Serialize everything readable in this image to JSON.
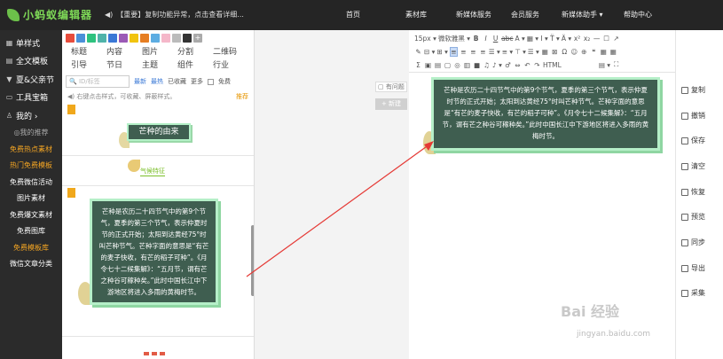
{
  "app": {
    "logo_text": "小蚂蚁编辑器",
    "notice": "【重要】复制功能异常，点击查看详细...",
    "nav": [
      "首页",
      "素材库",
      "新媒体服务",
      "会员服务",
      "新媒体助手 ▾",
      "帮助中心"
    ]
  },
  "sidebar": {
    "items": [
      {
        "icon": "单",
        "label": "单样式"
      },
      {
        "icon": "全",
        "label": "全文模板"
      },
      {
        "icon": "夏",
        "label": "夏&父亲节"
      },
      {
        "icon": "工",
        "label": "工具宝箱"
      },
      {
        "icon": "我",
        "label": "我的 ›"
      }
    ],
    "subs": [
      {
        "label": "◎我的推荐",
        "style": "dim"
      },
      {
        "label": "免费热点素材",
        "style": "hot"
      },
      {
        "label": "热门免费模板",
        "style": "hot"
      },
      {
        "label": "免费微信活动",
        "style": ""
      },
      {
        "label": "图片素材",
        "style": ""
      },
      {
        "label": "免费爆文素材",
        "style": ""
      },
      {
        "label": "免费图库",
        "style": ""
      },
      {
        "label": "免费模板库",
        "style": "hot"
      },
      {
        "label": "微信文章分类",
        "style": ""
      }
    ]
  },
  "panel": {
    "swatch_colors": [
      "#e74c3c",
      "#4a90d9",
      "#2ec27e",
      "#4fb3a9",
      "#3a78d6",
      "#9b59b6",
      "#f1c40f",
      "#e67e22",
      "#5dade2",
      "#f5b7c9",
      "#bbbbbb",
      "#333333"
    ],
    "categories": [
      "标题",
      "内容",
      "图片",
      "分割",
      "二维码",
      "引导",
      "节日",
      "主题",
      "组件",
      "行业"
    ],
    "search_placeholder": "ID/标签",
    "filters": [
      "最新",
      "最热",
      "已收藏",
      "更多",
      "免费"
    ],
    "tip": "◀) 右键点击样式，可收藏、屏蔽样式。",
    "tip_link": "推荐",
    "card1_title": "芒种的由来",
    "card2_label": "气候特征",
    "card3_text": "芒种是农历二十四节气中的第9个节气，夏季的第三个节气，表示仲夏时节的正式开始；太阳到达黄经75°时叫芒种节气。芒种字面的意思是“有芒的麦子快收，有芒的稻子可种”。《月令七十二候集解》：“五月节，谓有芒之种谷可稼种矣。”此时中国长江中下游地区将进入多雨的黄梅时节。"
  },
  "docs": {
    "tab_label": "有问题",
    "new_label": "+ 新建"
  },
  "toolbar": {
    "row1": [
      "15px ▾",
      "微软雅黑 ▾",
      "B",
      "I",
      "U",
      "abc",
      "A ▾",
      "▦ ▾",
      "I ▾",
      "T̈ ▾",
      "Ä ▾",
      "x²",
      "x₂",
      "—",
      "☐",
      "↗"
    ],
    "row2": [
      "✎",
      "⊟ ▾",
      "⊞ ▾",
      "≡",
      "≡",
      "≡",
      "≡",
      "☰ ▾",
      "≡ ▾",
      "⊤ ▾",
      "☰ ▾",
      "▦",
      "⊠",
      "Ω",
      "☺",
      "⊕",
      "❝",
      "▦",
      "▦"
    ],
    "row3": [
      "Σ",
      "▣",
      "▤",
      "▢",
      "◎",
      "▥",
      "■",
      "♫",
      "♪ ▾",
      "♂",
      "⇔",
      "↶",
      "↷",
      "HTML",
      "▤ ▾",
      "⛶"
    ]
  },
  "editor": {
    "card_text": "芒种是农历二十四节气中的第9个节气，夏季的第三个节气，表示仲夏时节的正式开始；太阳到达黄经75°时叫芒种节气。芒种字面的意思是“有芒的麦子快收，有芒的稻子可种”。《月令七十二候集解》：“五月节，谓有芒之种谷可稼种矣。”此时中国长江中下游地区将进入多雨的黄梅时节。"
  },
  "actions": [
    {
      "icon": "copy-icon",
      "label": "复制"
    },
    {
      "icon": "undo-icon",
      "label": "撤销"
    },
    {
      "icon": "save-icon",
      "label": "保存"
    },
    {
      "icon": "trash-icon",
      "label": "清空"
    },
    {
      "icon": "restore-icon",
      "label": "恢复"
    },
    {
      "icon": "preview-icon",
      "label": "预览"
    },
    {
      "icon": "sync-icon",
      "label": "同步"
    },
    {
      "icon": "export-icon",
      "label": "导出"
    },
    {
      "icon": "collect-icon",
      "label": "采集"
    }
  ],
  "watermark": {
    "text": "Bai 经验",
    "sub": "jingyan.baidu.com"
  },
  "colors": {
    "accent_green": "#7ed957",
    "card_bg": "#3f5e50",
    "card_border": "#b5efc8",
    "arrow": "#e53935"
  }
}
